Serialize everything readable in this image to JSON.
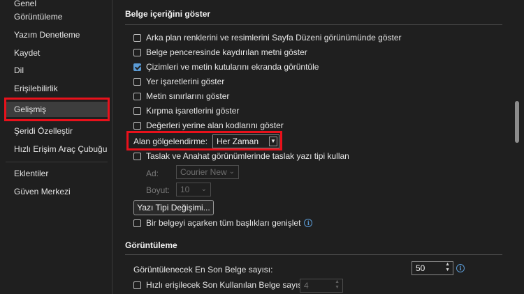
{
  "sidebar": {
    "items": [
      {
        "label": "Genel"
      },
      {
        "label": "Görüntüleme"
      },
      {
        "label": "Yazım Denetleme"
      },
      {
        "label": "Kaydet"
      },
      {
        "label": "Dil"
      },
      {
        "label": "Erişilebilirlik"
      },
      {
        "label": "Gelişmiş",
        "selected": true
      },
      {
        "label": "Şeridi Özelleştir"
      },
      {
        "label": "Hızlı Erişim Araç Çubuğu"
      },
      {
        "label": "Eklentiler"
      },
      {
        "label": "Güven Merkezi"
      }
    ]
  },
  "section1": {
    "title": "Belge içeriğini göster",
    "options": [
      {
        "label": "Arka plan renklerini ve resimlerini Sayfa Düzeni görünümünde göster",
        "checked": false
      },
      {
        "label": "Belge penceresinde kaydırılan metni göster",
        "checked": false
      },
      {
        "label": "Çizimleri ve metin kutularını ekranda görüntüle",
        "checked": true
      },
      {
        "label": "Yer işaretlerini göster",
        "checked": false
      },
      {
        "label": "Metin sınırlarını göster",
        "checked": false
      },
      {
        "label": "Kırpma işaretlerini göster",
        "checked": false
      },
      {
        "label": "Değerleri yerine alan kodlarını göster",
        "checked": false
      }
    ],
    "field_shading": {
      "label": "Alan gölgelendirme:",
      "value": "Her Zaman"
    },
    "draft_font": {
      "label": "Taslak ve Anahat görünümlerinde taslak yazı tipi kullan",
      "checked": false
    },
    "font_name": {
      "label": "Ad:",
      "value": "Courier New"
    },
    "font_size": {
      "label": "Boyut:",
      "value": "10"
    },
    "font_sub_button": "Yazı Tipi Değişimi...",
    "expand_headings": {
      "label": "Bir belgeyi açarken tüm başlıkları genişlet",
      "checked": false
    }
  },
  "section2": {
    "title": "Görüntüleme",
    "recent_docs": {
      "label": "Görüntülenecek En Son Belge sayısı:",
      "value": "50"
    },
    "quick_access": {
      "label": "Hızlı erişilecek Son Kullanılan Belge sayısı:",
      "value": "4",
      "checked": false
    }
  },
  "colors": {
    "accent": "#5b9bd5",
    "highlight": "#e8111b",
    "background": "#1f1f1f"
  }
}
